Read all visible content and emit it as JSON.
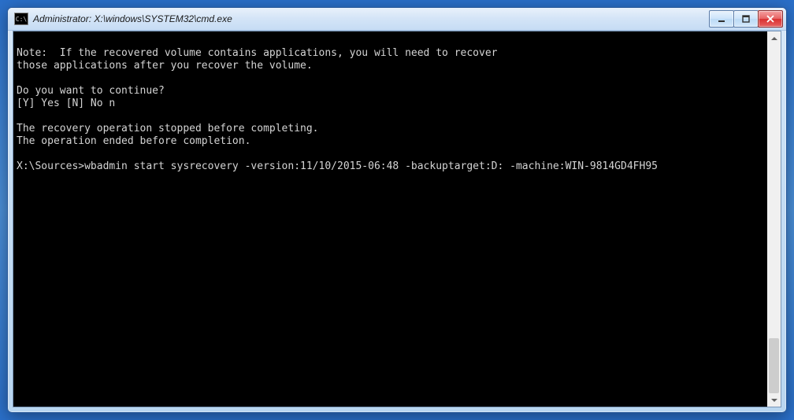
{
  "window": {
    "title": "Administrator: X:\\windows\\SYSTEM32\\cmd.exe",
    "icon_label": "C:\\"
  },
  "console": {
    "blank_top": " ",
    "note_line1": "Note:  If the recovered volume contains applications, you will need to recover",
    "note_line2": "those applications after you recover the volume.",
    "blank1": " ",
    "prompt_continue": "Do you want to continue?",
    "answer_line": "[Y] Yes [N] No n",
    "blank2": " ",
    "stopped_line": "The recovery operation stopped before completing.",
    "ended_line": "The operation ended before completion.",
    "blank3": " ",
    "cmd_line": "X:\\Sources>wbadmin start sysrecovery -version:11/10/2015-06:48 -backuptarget:D: -machine:WIN-9814GD4FH95"
  }
}
